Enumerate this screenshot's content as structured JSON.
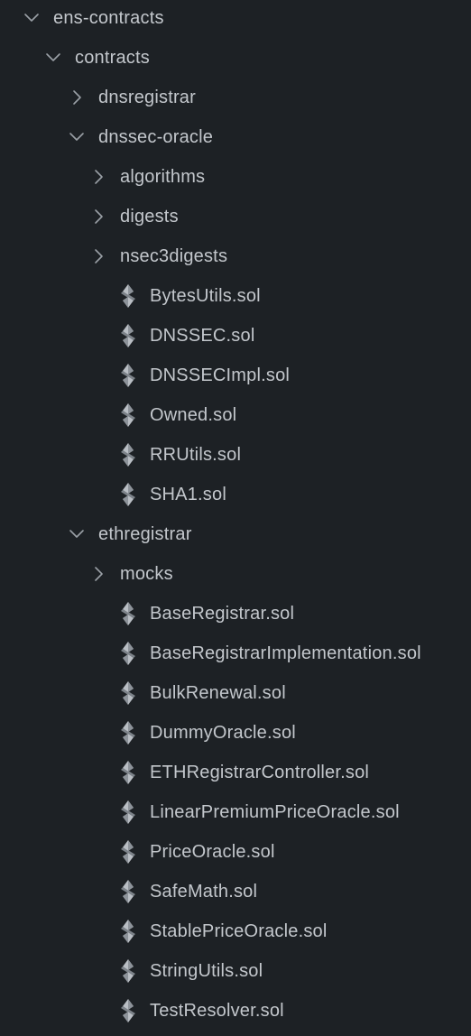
{
  "explorer": {
    "items": [
      {
        "type": "folder",
        "expanded": true,
        "label": "ens-contracts",
        "depth": 0,
        "icon": "chevron-down-icon"
      },
      {
        "type": "folder",
        "expanded": true,
        "label": "contracts",
        "depth": 1,
        "icon": "chevron-down-icon"
      },
      {
        "type": "folder",
        "expanded": false,
        "label": "dnsregistrar",
        "depth": 2,
        "icon": "chevron-right-icon"
      },
      {
        "type": "folder",
        "expanded": true,
        "label": "dnssec-oracle",
        "depth": 2,
        "icon": "chevron-down-icon"
      },
      {
        "type": "folder",
        "expanded": false,
        "label": "algorithms",
        "depth": 3,
        "icon": "chevron-right-icon"
      },
      {
        "type": "folder",
        "expanded": false,
        "label": "digests",
        "depth": 3,
        "icon": "chevron-right-icon"
      },
      {
        "type": "folder",
        "expanded": false,
        "label": "nsec3digests",
        "depth": 3,
        "icon": "chevron-right-icon"
      },
      {
        "type": "file",
        "label": "BytesUtils.sol",
        "depth": 4,
        "icon": "solidity-file-icon"
      },
      {
        "type": "file",
        "label": "DNSSEC.sol",
        "depth": 4,
        "icon": "solidity-file-icon"
      },
      {
        "type": "file",
        "label": "DNSSECImpl.sol",
        "depth": 4,
        "icon": "solidity-file-icon"
      },
      {
        "type": "file",
        "label": "Owned.sol",
        "depth": 4,
        "icon": "solidity-file-icon"
      },
      {
        "type": "file",
        "label": "RRUtils.sol",
        "depth": 4,
        "icon": "solidity-file-icon"
      },
      {
        "type": "file",
        "label": "SHA1.sol",
        "depth": 4,
        "icon": "solidity-file-icon"
      },
      {
        "type": "folder",
        "expanded": true,
        "label": "ethregistrar",
        "depth": 2,
        "icon": "chevron-down-icon"
      },
      {
        "type": "folder",
        "expanded": false,
        "label": "mocks",
        "depth": 3,
        "icon": "chevron-right-icon"
      },
      {
        "type": "file",
        "label": "BaseRegistrar.sol",
        "depth": 4,
        "icon": "solidity-file-icon"
      },
      {
        "type": "file",
        "label": "BaseRegistrarImplementation.sol",
        "depth": 4,
        "icon": "solidity-file-icon"
      },
      {
        "type": "file",
        "label": "BulkRenewal.sol",
        "depth": 4,
        "icon": "solidity-file-icon"
      },
      {
        "type": "file",
        "label": "DummyOracle.sol",
        "depth": 4,
        "icon": "solidity-file-icon"
      },
      {
        "type": "file",
        "label": "ETHRegistrarController.sol",
        "depth": 4,
        "icon": "solidity-file-icon"
      },
      {
        "type": "file",
        "label": "LinearPremiumPriceOracle.sol",
        "depth": 4,
        "icon": "solidity-file-icon"
      },
      {
        "type": "file",
        "label": "PriceOracle.sol",
        "depth": 4,
        "icon": "solidity-file-icon"
      },
      {
        "type": "file",
        "label": "SafeMath.sol",
        "depth": 4,
        "icon": "solidity-file-icon"
      },
      {
        "type": "file",
        "label": "StablePriceOracle.sol",
        "depth": 4,
        "icon": "solidity-file-icon"
      },
      {
        "type": "file",
        "label": "StringUtils.sol",
        "depth": 4,
        "icon": "solidity-file-icon"
      },
      {
        "type": "file",
        "label": "TestResolver.sol",
        "depth": 4,
        "icon": "solidity-file-icon"
      }
    ]
  },
  "colors": {
    "background": "#1d2125",
    "text": "#c3c7cc",
    "chevron": "#9aa0a6",
    "icon_light": "#b9bec4",
    "icon_dark": "#7d838a"
  }
}
